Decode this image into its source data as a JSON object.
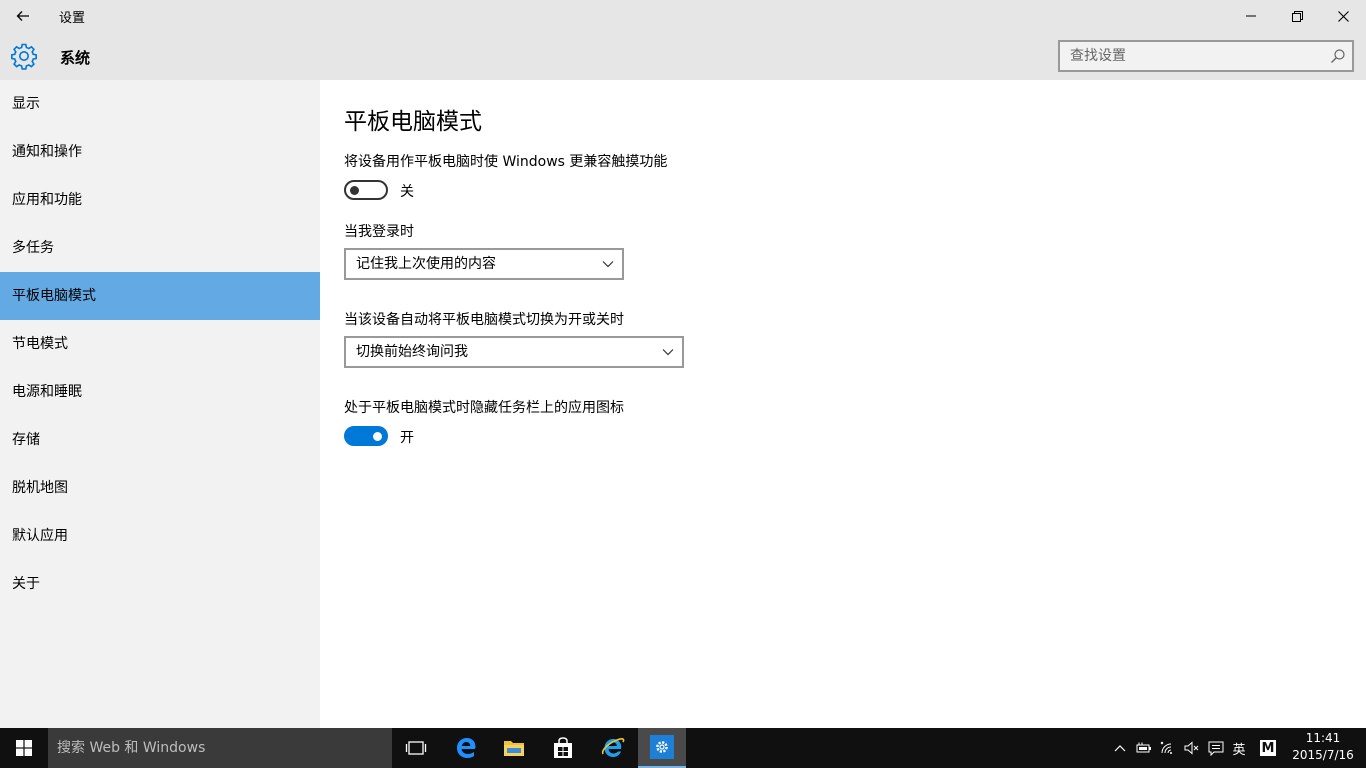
{
  "window": {
    "title": "设置"
  },
  "header": {
    "section_title": "系统",
    "search": {
      "placeholder": "查找设置"
    }
  },
  "sidebar": {
    "items": [
      {
        "label": "显示"
      },
      {
        "label": "通知和操作"
      },
      {
        "label": "应用和功能"
      },
      {
        "label": "多任务"
      },
      {
        "label": "平板电脑模式",
        "selected": true
      },
      {
        "label": "节电模式"
      },
      {
        "label": "电源和睡眠"
      },
      {
        "label": "存储"
      },
      {
        "label": "脱机地图"
      },
      {
        "label": "默认应用"
      },
      {
        "label": "关于"
      }
    ]
  },
  "main": {
    "title": "平板电脑模式",
    "touch_setting": {
      "label": "将设备用作平板电脑时使 Windows 更兼容触摸功能",
      "state": "关",
      "on": false
    },
    "signin_setting": {
      "label": "当我登录时",
      "value": "记住我上次使用的内容"
    },
    "auto_switch_setting": {
      "label": "当该设备自动将平板电脑模式切换为开或关时",
      "value": "切换前始终询问我"
    },
    "hide_icons_setting": {
      "label": "处于平板电脑模式时隐藏任务栏上的应用图标",
      "state": "开",
      "on": true
    }
  },
  "taskbar": {
    "search_placeholder": "搜索 Web 和 Windows",
    "tray": {
      "ime": "英",
      "ime_mode": "M"
    },
    "clock": {
      "time": "11:41",
      "date": "2015/7/16"
    }
  },
  "colors": {
    "accent": "#0078d7",
    "selected_nav": "#63a9e3",
    "chrome": "#e6e6e6",
    "sidebar": "#f2f2f2",
    "taskbar": "#101010"
  }
}
